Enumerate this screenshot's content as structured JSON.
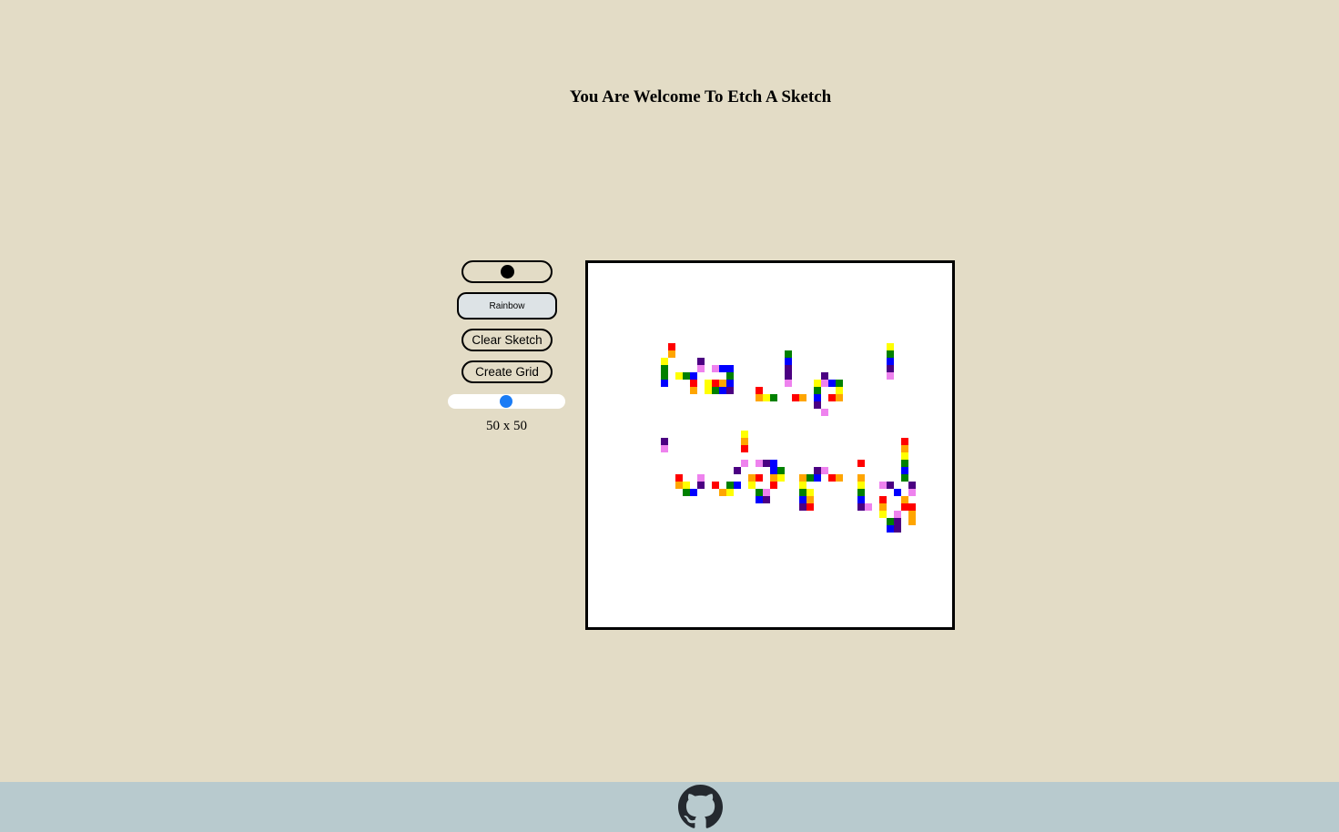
{
  "header": {
    "title": "You Are Welcome To Etch A Sketch"
  },
  "controls": {
    "color_picker_value": "#000000",
    "rainbow_label": "Rainbow",
    "clear_label": "Clear Sketch",
    "create_label": "Create Grid",
    "grid_size": 50,
    "grid_size_min": 1,
    "grid_size_max": 100,
    "grid_size_label": "50 x 50"
  },
  "sketch": {
    "palette": {
      "r": "#ff0000",
      "o": "#ffa500",
      "y": "#ffff00",
      "g": "#008000",
      "b": "#0000ff",
      "i": "#4b0082",
      "v": "#ee82ee"
    },
    "rows": {
      "11": [
        [
          11,
          "r"
        ],
        [
          41,
          "y"
        ]
      ],
      "12": [
        [
          11,
          "o"
        ],
        [
          41,
          "g"
        ],
        [
          27,
          "g"
        ]
      ],
      "13": [
        [
          10,
          "y"
        ],
        [
          15,
          "i"
        ],
        [
          41,
          "b"
        ],
        [
          27,
          "b"
        ]
      ],
      "14": [
        [
          10,
          "g"
        ],
        [
          15,
          "v"
        ],
        [
          17,
          "v"
        ],
        [
          18,
          "b"
        ],
        [
          19,
          "b"
        ],
        [
          41,
          "i"
        ],
        [
          27,
          "i"
        ]
      ],
      "15": [
        [
          10,
          "g"
        ],
        [
          12,
          "y"
        ],
        [
          13,
          "g"
        ],
        [
          14,
          "b"
        ],
        [
          19,
          "g"
        ],
        [
          41,
          "v"
        ],
        [
          27,
          "i"
        ],
        [
          32,
          "i"
        ]
      ],
      "16": [
        [
          10,
          "b"
        ],
        [
          14,
          "r"
        ],
        [
          16,
          "y"
        ],
        [
          17,
          "r"
        ],
        [
          18,
          "o"
        ],
        [
          19,
          "b"
        ],
        [
          27,
          "v"
        ],
        [
          31,
          "y"
        ],
        [
          32,
          "v"
        ],
        [
          33,
          "b"
        ],
        [
          34,
          "g"
        ]
      ],
      "17": [
        [
          14,
          "o"
        ],
        [
          16,
          "y"
        ],
        [
          17,
          "g"
        ],
        [
          18,
          "b"
        ],
        [
          19,
          "i"
        ],
        [
          23,
          "r"
        ],
        [
          31,
          "g"
        ],
        [
          34,
          "y"
        ]
      ],
      "18": [
        [
          23,
          "o"
        ],
        [
          24,
          "y"
        ],
        [
          25,
          "g"
        ],
        [
          28,
          "r"
        ],
        [
          29,
          "o"
        ],
        [
          31,
          "b"
        ],
        [
          33,
          "r"
        ],
        [
          34,
          "o"
        ]
      ],
      "19": [
        [
          31,
          "i"
        ]
      ],
      "20": [
        [
          32,
          "v"
        ]
      ],
      "23": [
        [
          21,
          "y"
        ]
      ],
      "24": [
        [
          10,
          "i"
        ],
        [
          21,
          "o"
        ],
        [
          43,
          "r"
        ]
      ],
      "25": [
        [
          10,
          "v"
        ],
        [
          21,
          "r"
        ],
        [
          43,
          "o"
        ]
      ],
      "26": [
        [
          43,
          "y"
        ]
      ],
      "27": [
        [
          21,
          "v"
        ],
        [
          23,
          "v"
        ],
        [
          24,
          "i"
        ],
        [
          25,
          "b"
        ],
        [
          37,
          "r"
        ],
        [
          43,
          "g"
        ]
      ],
      "28": [
        [
          20,
          "i"
        ],
        [
          25,
          "b"
        ],
        [
          26,
          "g"
        ],
        [
          31,
          "i"
        ],
        [
          32,
          "v"
        ],
        [
          43,
          "b"
        ]
      ],
      "29": [
        [
          12,
          "r"
        ],
        [
          15,
          "v"
        ],
        [
          22,
          "o"
        ],
        [
          23,
          "r"
        ],
        [
          25,
          "o"
        ],
        [
          26,
          "y"
        ],
        [
          29,
          "o"
        ],
        [
          30,
          "g"
        ],
        [
          31,
          "b"
        ],
        [
          33,
          "r"
        ],
        [
          34,
          "o"
        ],
        [
          37,
          "o"
        ],
        [
          43,
          "g"
        ]
      ],
      "30": [
        [
          12,
          "o"
        ],
        [
          13,
          "y"
        ],
        [
          15,
          "i"
        ],
        [
          17,
          "r"
        ],
        [
          19,
          "g"
        ],
        [
          20,
          "b"
        ],
        [
          22,
          "y"
        ],
        [
          25,
          "r"
        ],
        [
          29,
          "y"
        ],
        [
          37,
          "y"
        ],
        [
          40,
          "v"
        ],
        [
          41,
          "i"
        ],
        [
          44,
          "i"
        ]
      ],
      "31": [
        [
          13,
          "g"
        ],
        [
          14,
          "b"
        ],
        [
          18,
          "o"
        ],
        [
          19,
          "y"
        ],
        [
          23,
          "g"
        ],
        [
          24,
          "v"
        ],
        [
          29,
          "g"
        ],
        [
          30,
          "y"
        ],
        [
          37,
          "g"
        ],
        [
          42,
          "b"
        ],
        [
          44,
          "v"
        ]
      ],
      "32": [
        [
          23,
          "b"
        ],
        [
          24,
          "i"
        ],
        [
          29,
          "b"
        ],
        [
          30,
          "o"
        ],
        [
          37,
          "b"
        ],
        [
          40,
          "r"
        ],
        [
          43,
          "o"
        ]
      ],
      "33": [
        [
          29,
          "i"
        ],
        [
          30,
          "r"
        ],
        [
          37,
          "i"
        ],
        [
          38,
          "v"
        ],
        [
          40,
          "o"
        ],
        [
          43,
          "r"
        ],
        [
          44,
          "r"
        ]
      ],
      "34": [
        [
          40,
          "y"
        ],
        [
          42,
          "v"
        ],
        [
          44,
          "o"
        ]
      ],
      "35": [
        [
          41,
          "g"
        ],
        [
          42,
          "i"
        ],
        [
          44,
          "o"
        ]
      ],
      "36": [
        [
          41,
          "b"
        ],
        [
          42,
          "i"
        ]
      ]
    }
  }
}
